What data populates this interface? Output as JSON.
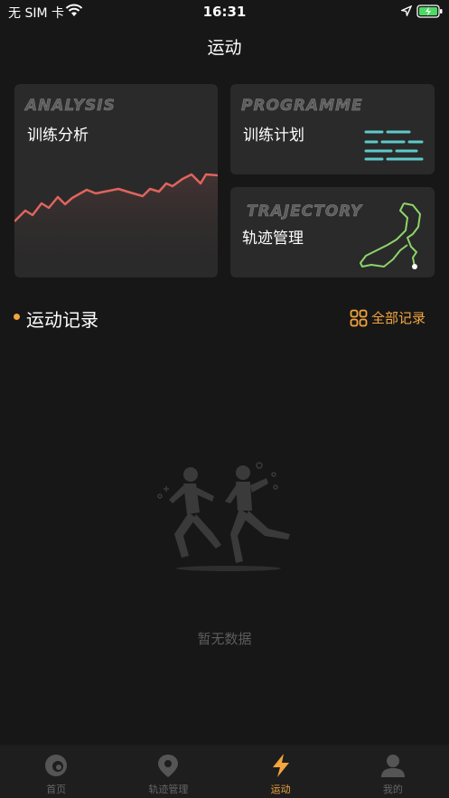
{
  "status": {
    "carrier": "无 SIM 卡",
    "time": "16:31"
  },
  "header": {
    "title": "运动"
  },
  "cards": {
    "analysis": {
      "en": "ANALYSIS",
      "cn": "训练分析"
    },
    "programme": {
      "en": "PROGRAMME",
      "cn": "训练计划"
    },
    "trajectory": {
      "en": "TRAJECTORY",
      "cn": "轨迹管理"
    }
  },
  "section": {
    "title": "运动记录",
    "all_label": "全部记录"
  },
  "empty": {
    "text": "暂无数据"
  },
  "tabs": [
    {
      "label": "首页",
      "icon": "home-icon"
    },
    {
      "label": "轨迹管理",
      "icon": "location-pin-icon"
    },
    {
      "label": "运动",
      "icon": "lightning-icon"
    },
    {
      "label": "我的",
      "icon": "user-icon"
    }
  ],
  "colors": {
    "accent": "#f3a53e",
    "chart_line": "#e0645e",
    "route": "#8fd46b",
    "plan_lines": "#5ec9c9"
  }
}
